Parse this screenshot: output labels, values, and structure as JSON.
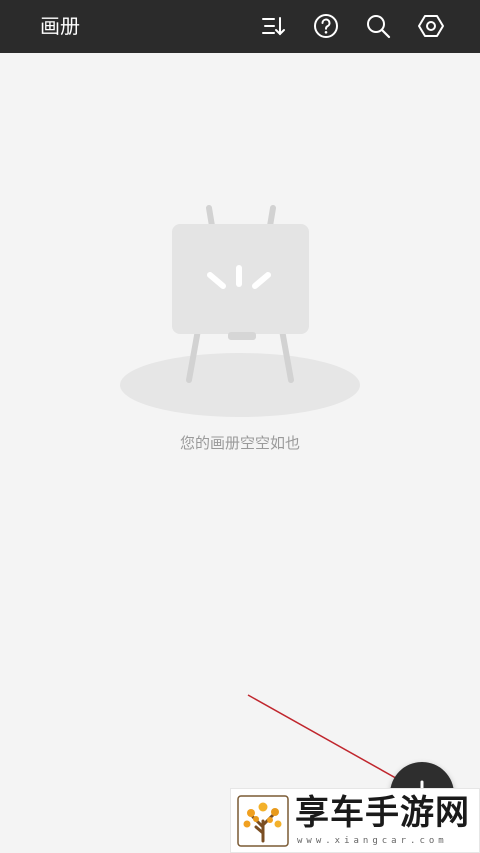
{
  "header": {
    "title": "画册",
    "icons": [
      "sort-icon",
      "help-icon",
      "search-icon",
      "settings-icon"
    ]
  },
  "empty_state": {
    "message": "您的画册空空如也",
    "illustration": "easel-icon"
  },
  "fab": {
    "icon": "add-icon"
  },
  "watermark": {
    "name": "享车手游网",
    "url": "www.xiangcar.com"
  },
  "colors": {
    "header_bg": "#2b2b2b",
    "page_bg": "#f4f4f4",
    "empty_text": "#9a9a9a",
    "annotation_arrow": "#c0262d"
  }
}
